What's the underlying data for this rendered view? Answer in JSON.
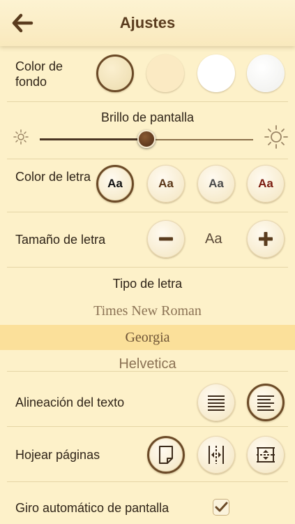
{
  "header": {
    "title": "Ajustes",
    "back_icon": "arrow-left-icon"
  },
  "background_color": {
    "label": "Color de fondo",
    "options": [
      {
        "name": "parchment",
        "color": "#f6e6bf",
        "selected": true
      },
      {
        "name": "cream",
        "color": "#fbeac3",
        "selected": false
      },
      {
        "name": "white",
        "color": "#ffffff",
        "selected": false
      },
      {
        "name": "paper",
        "color": "#f7f7f5",
        "selected": false
      }
    ]
  },
  "brightness": {
    "label": "Brillo de pantalla",
    "value_fraction": 0.5
  },
  "text_color": {
    "label": "Color de letra",
    "sample": "Aa",
    "options": [
      {
        "color": "#111111",
        "selected": true
      },
      {
        "color": "#5a3617",
        "selected": false
      },
      {
        "color": "#4a4a4a",
        "selected": false
      },
      {
        "color": "#7a1a0e",
        "selected": false
      }
    ]
  },
  "text_size": {
    "label": "Tamaño de letra",
    "sample": "Aa",
    "minus": "−",
    "plus": "+"
  },
  "font_family": {
    "label": "Tipo de letra",
    "options": [
      "Times New Roman",
      "Georgia",
      "Helvetica"
    ],
    "selected": "Georgia"
  },
  "alignment": {
    "label": "Alineación del texto"
  },
  "page_turn": {
    "label": "Hojear páginas"
  },
  "auto_rotate": {
    "label": "Giro automático de pantalla",
    "checked": true
  }
}
